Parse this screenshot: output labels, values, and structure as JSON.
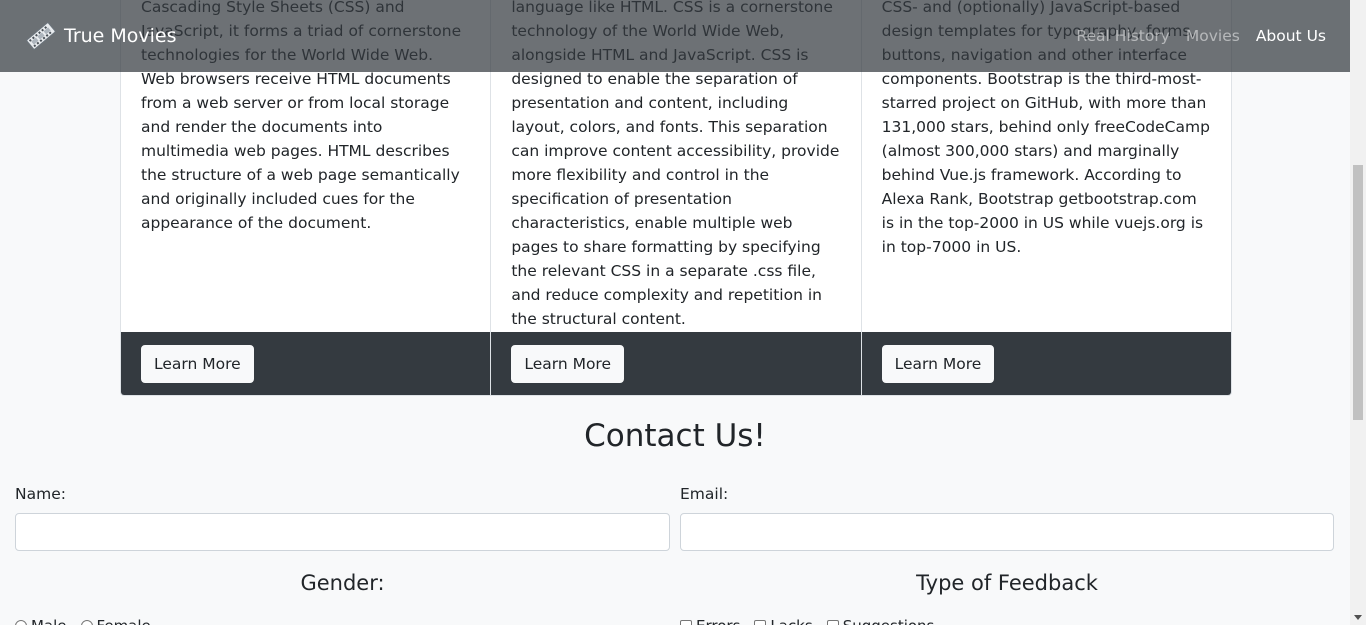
{
  "navbar": {
    "brand": "True Movies",
    "brand_icon": "film-reel-icon",
    "links": [
      {
        "label": "Real History",
        "active": false
      },
      {
        "label": "Movies",
        "active": false
      },
      {
        "label": "About Us",
        "active": true
      }
    ]
  },
  "cards": [
    {
      "text": "pages and web applications. With Cascading Style Sheets (CSS) and JavaScript, it forms a triad of cornerstone technologies for the World Wide Web. Web browsers receive HTML documents from a web server or from local storage and render the documents into multimedia web pages. HTML describes the structure of a web page semantically and originally included cues for the appearance of the document.",
      "button": "Learn More"
    },
    {
      "text": "of a document written in a markup language like HTML. CSS is a cornerstone technology of the World Wide Web, alongside HTML and JavaScript. CSS is designed to enable the separation of presentation and content, including layout, colors, and fonts. This separation can improve content accessibility, provide more flexibility and control in the specification of presentation characteristics, enable multiple web pages to share formatting by specifying the relevant CSS in a separate .css file, and reduce complexity and repetition in the structural content.",
      "button": "Learn More"
    },
    {
      "text": "front-end web development. It contains CSS- and (optionally) JavaScript-based design templates for typography, forms, buttons, navigation and other interface components. Bootstrap is the third-most-starred project on GitHub, with more than 131,000 stars, behind only freeCodeCamp (almost 300,000 stars) and marginally behind Vue.js framework. According to Alexa Rank, Bootstrap getbootstrap.com is in the top-2000 in US while vuejs.org is in top-7000 in US.",
      "button": "Learn More"
    }
  ],
  "contact": {
    "title": "Contact Us!",
    "name_label": "Name:",
    "name_value": "",
    "email_label": "Email:",
    "email_value": "",
    "gender_heading": "Gender:",
    "gender_options": [
      "Male",
      "Female"
    ],
    "feedback_heading": "Type of Feedback",
    "feedback_options": [
      "Errors",
      "Lacks",
      "Suggestions"
    ]
  },
  "colors": {
    "navbar_bg": "#343a40",
    "card_footer_bg": "#343a40",
    "page_bg": "#f8f9fa"
  }
}
